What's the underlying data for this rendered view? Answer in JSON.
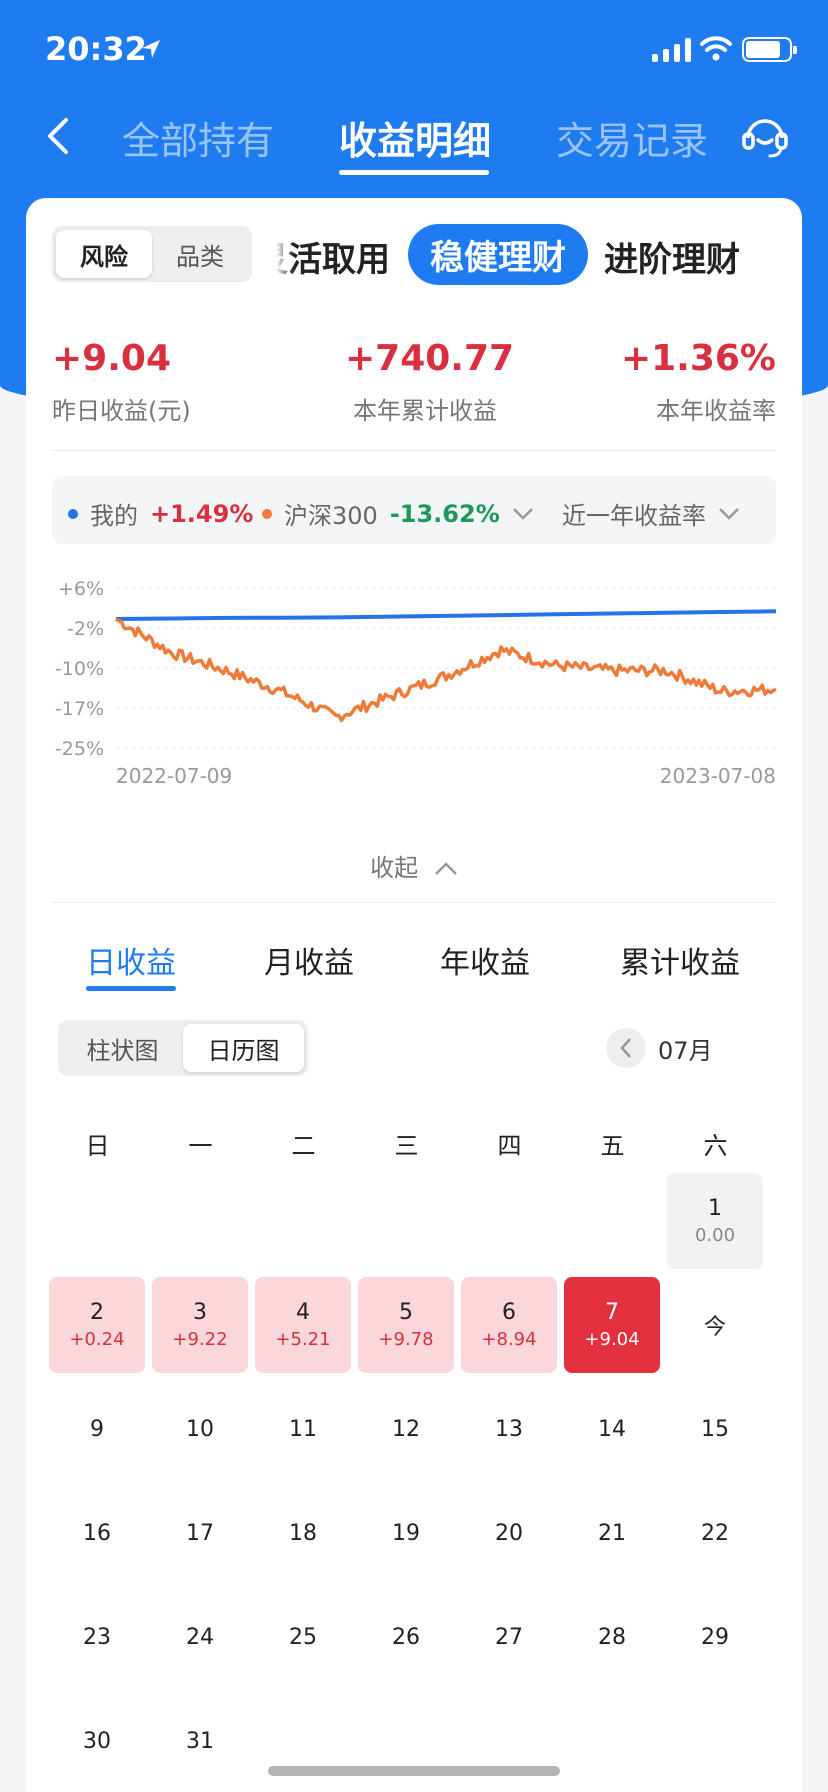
{
  "status": {
    "time": "20:32"
  },
  "nav": {
    "tabs": [
      {
        "label": "全部持有",
        "active": false
      },
      {
        "label": "收益明细",
        "active": true
      },
      {
        "label": "交易记录",
        "active": false
      }
    ]
  },
  "segment": {
    "options": [
      "风险",
      "品类"
    ],
    "selected": 0
  },
  "categories": [
    {
      "label": "灵活取用",
      "active": false
    },
    {
      "label": "稳健理财",
      "active": true
    },
    {
      "label": "进阶理财",
      "active": false
    }
  ],
  "metrics": [
    {
      "value": "+9.04",
      "label": "昨日收益(元)"
    },
    {
      "value": "+740.77",
      "label": "本年累计收益"
    },
    {
      "value": "+1.36%",
      "label": "本年收益率"
    }
  ],
  "legend": {
    "mine_label": "我的",
    "mine_value": "+1.49%",
    "bench_label": "沪深300",
    "bench_value": "-13.62%",
    "period": "近一年收益率"
  },
  "colors": {
    "accent": "#1f7cf0",
    "mine": "#2474e8",
    "bench": "#f07a3a",
    "gain": "#d8303f",
    "loss": "#1a9a5a"
  },
  "chart_data": {
    "type": "line",
    "x": [
      "2022-07-09",
      "2022-08-09",
      "2022-09-09",
      "2022-10-09",
      "2022-11-09",
      "2022-12-09",
      "2023-01-09",
      "2023-02-09",
      "2023-03-09",
      "2023-04-09",
      "2023-05-09",
      "2023-06-09",
      "2023-07-08"
    ],
    "series": [
      {
        "name": "我的",
        "values": [
          0,
          0.1,
          0.2,
          0.25,
          0.3,
          0.45,
          0.6,
          0.75,
          0.9,
          1.05,
          1.2,
          1.35,
          1.49
        ]
      },
      {
        "name": "沪深300",
        "values": [
          0,
          -6.5,
          -10,
          -14,
          -19,
          -15,
          -11,
          -6,
          -9,
          -10,
          -10,
          -14,
          -13.62
        ]
      }
    ],
    "yticks": [
      "+6%",
      "-2%",
      "-10%",
      "-17%",
      "-25%"
    ],
    "ylim": [
      -25,
      6
    ],
    "xticks": [
      "2022-07-09",
      "2023-07-08"
    ],
    "grid": true
  },
  "collapse_label": "收起",
  "sub_tabs": [
    {
      "label": "日收益",
      "active": true
    },
    {
      "label": "月收益",
      "active": false
    },
    {
      "label": "年收益",
      "active": false
    },
    {
      "label": "累计收益",
      "active": false
    }
  ],
  "view_toggle": {
    "options": [
      "柱状图",
      "日历图"
    ],
    "selected": 1
  },
  "month": "07月",
  "weekdays": [
    "日",
    "一",
    "二",
    "三",
    "四",
    "五",
    "六"
  ],
  "calendar": [
    {
      "day": "1",
      "profit": "0.00",
      "state": "flat",
      "col": 6,
      "row": 0
    },
    {
      "day": "2",
      "profit": "+0.24",
      "state": "gain",
      "col": 0,
      "row": 1
    },
    {
      "day": "3",
      "profit": "+9.22",
      "state": "gain",
      "col": 1,
      "row": 1
    },
    {
      "day": "4",
      "profit": "+5.21",
      "state": "gain",
      "col": 2,
      "row": 1
    },
    {
      "day": "5",
      "profit": "+9.78",
      "state": "gain",
      "col": 3,
      "row": 1
    },
    {
      "day": "6",
      "profit": "+8.94",
      "state": "gain",
      "col": 4,
      "row": 1
    },
    {
      "day": "7",
      "profit": "+9.04",
      "state": "today-gain",
      "col": 5,
      "row": 1
    },
    {
      "day": "今",
      "profit": "",
      "state": "none",
      "col": 6,
      "row": 1
    },
    {
      "day": "9",
      "col": 0,
      "row": 2
    },
    {
      "day": "10",
      "col": 1,
      "row": 2
    },
    {
      "day": "11",
      "col": 2,
      "row": 2
    },
    {
      "day": "12",
      "col": 3,
      "row": 2
    },
    {
      "day": "13",
      "col": 4,
      "row": 2
    },
    {
      "day": "14",
      "col": 5,
      "row": 2
    },
    {
      "day": "15",
      "col": 6,
      "row": 2
    },
    {
      "day": "16",
      "col": 0,
      "row": 3
    },
    {
      "day": "17",
      "col": 1,
      "row": 3
    },
    {
      "day": "18",
      "col": 2,
      "row": 3
    },
    {
      "day": "19",
      "col": 3,
      "row": 3
    },
    {
      "day": "20",
      "col": 4,
      "row": 3
    },
    {
      "day": "21",
      "col": 5,
      "row": 3
    },
    {
      "day": "22",
      "col": 6,
      "row": 3
    },
    {
      "day": "23",
      "col": 0,
      "row": 4
    },
    {
      "day": "24",
      "col": 1,
      "row": 4
    },
    {
      "day": "25",
      "col": 2,
      "row": 4
    },
    {
      "day": "26",
      "col": 3,
      "row": 4
    },
    {
      "day": "27",
      "col": 4,
      "row": 4
    },
    {
      "day": "28",
      "col": 5,
      "row": 4
    },
    {
      "day": "29",
      "col": 6,
      "row": 4
    },
    {
      "day": "30",
      "col": 0,
      "row": 5
    },
    {
      "day": "31",
      "col": 1,
      "row": 5
    }
  ]
}
